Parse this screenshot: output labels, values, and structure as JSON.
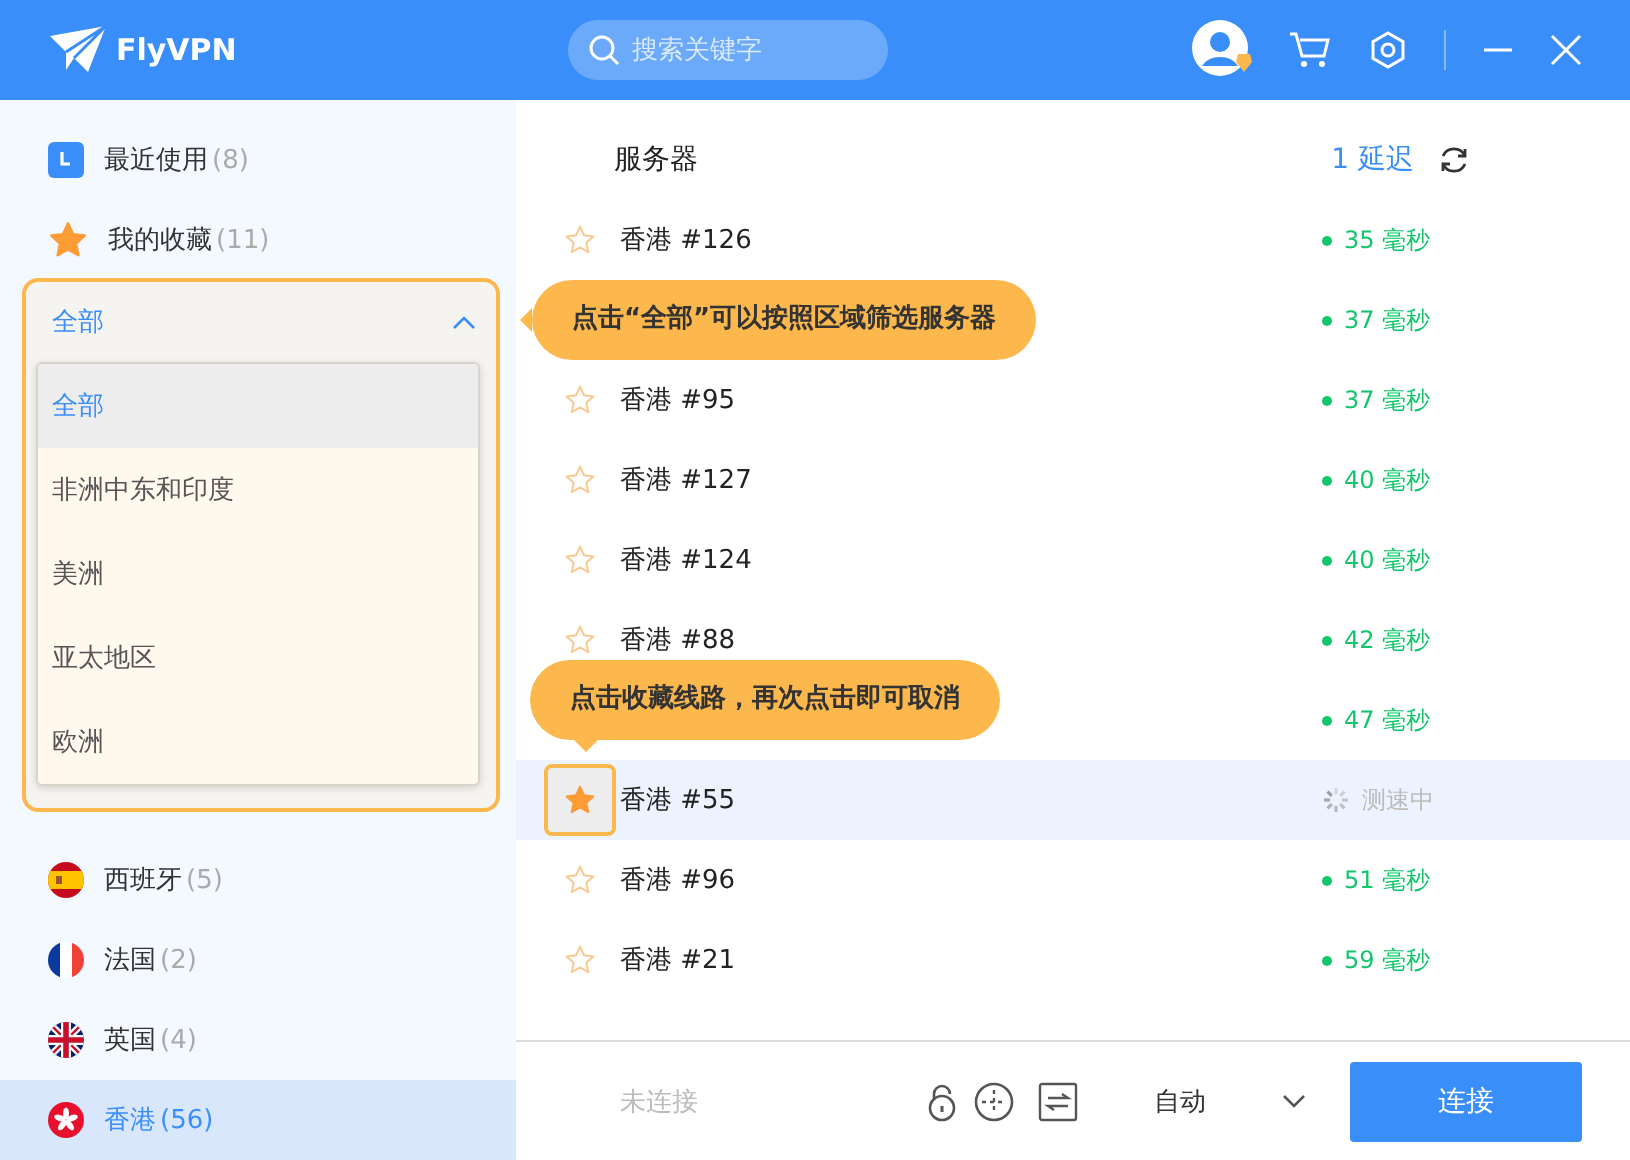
{
  "header": {
    "app_name": "FlyVPN",
    "search": {
      "placeholder": "搜索关键字"
    }
  },
  "sidebar": {
    "items": [
      {
        "kind": "recent",
        "label": "最近使用",
        "count": "(8)",
        "selected": false
      },
      {
        "kind": "favorites",
        "label": "我的收藏",
        "count": "(11)",
        "selected": false
      }
    ],
    "region_filter": {
      "value": "全部",
      "expanded": true,
      "options": [
        {
          "label": "全部",
          "selected": true
        },
        {
          "label": "非洲中东和印度",
          "selected": false
        },
        {
          "label": "美洲",
          "selected": false
        },
        {
          "label": "亚太地区",
          "selected": false
        },
        {
          "label": "欧洲",
          "selected": false
        }
      ]
    },
    "countries": [
      {
        "kind": "spain",
        "label": "西班牙",
        "count": "(5)",
        "selected": false
      },
      {
        "kind": "france",
        "label": "法国",
        "count": "(2)",
        "selected": false
      },
      {
        "kind": "uk",
        "label": "英国",
        "count": "(4)",
        "selected": false
      },
      {
        "kind": "hongkong",
        "label": "香港",
        "count": "(56)",
        "selected": true
      }
    ]
  },
  "server_list": {
    "column_server": "服务器",
    "sort_label": "1 延迟",
    "rows": [
      {
        "name": "香港 #126",
        "starred": false,
        "selected": false,
        "kind": "latency",
        "latency": "35 毫秒"
      },
      {
        "selected": false,
        "kind": "latency",
        "latency": "37 毫秒"
      },
      {
        "name": "香港 #95",
        "starred": false,
        "selected": false,
        "kind": "latency",
        "latency": "37 毫秒"
      },
      {
        "name": "香港 #127",
        "starred": false,
        "selected": false,
        "kind": "latency",
        "latency": "40 毫秒"
      },
      {
        "name": "香港 #124",
        "starred": false,
        "selected": false,
        "kind": "latency",
        "latency": "40 毫秒"
      },
      {
        "name": "香港 #88",
        "starred": false,
        "selected": false,
        "kind": "latency",
        "latency": "42 毫秒"
      },
      {
        "selected": false,
        "kind": "latency",
        "latency": "47 毫秒"
      },
      {
        "name": "香港 #55",
        "starred": true,
        "selected": true,
        "kind": "testing",
        "latency": "测速中"
      },
      {
        "name": "香港 #96",
        "starred": false,
        "selected": false,
        "kind": "latency",
        "latency": "51 毫秒"
      },
      {
        "name": "香港 #21",
        "starred": false,
        "selected": false,
        "kind": "latency",
        "latency": "59 毫秒"
      }
    ]
  },
  "tooltips": [
    {
      "kind": "left",
      "text": "点击“全部”可以按照区域筛选服务器"
    },
    {
      "kind": "down",
      "text": "点击收藏线路，再次点击即可取消"
    }
  ],
  "footer": {
    "status": "未连接",
    "protocol": "自动",
    "connect_button": "连接"
  }
}
